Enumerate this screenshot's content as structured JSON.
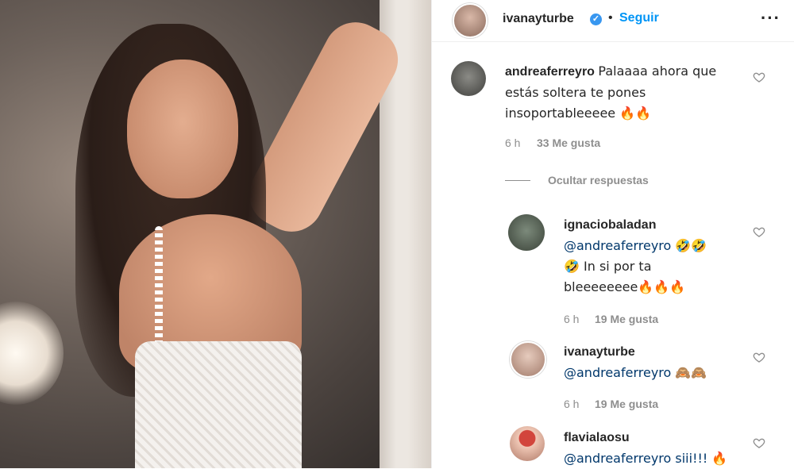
{
  "header": {
    "username": "ivanayturbe",
    "verified_mark": "✓",
    "separator": "•",
    "follow_label": "Seguir",
    "more_label": "···"
  },
  "comment": {
    "username": "andreaferreyro",
    "lines": [
      "Palaaaa ahora que",
      "estás soltera te pones",
      "insoportableeeee 🔥🔥"
    ],
    "time": "6 h",
    "likes": "33 Me gusta"
  },
  "hide_replies_label": "Ocultar respuestas",
  "replies": [
    {
      "username": "ignaciobaladan",
      "lines": [
        "@andreaferreyro 🤣🤣",
        "🤣 In si por ta",
        "bleeeeeeee🔥🔥🔥"
      ],
      "time": "6 h",
      "likes": "19 Me gusta"
    },
    {
      "username": "ivanayturbe",
      "lines": [
        "@andreaferreyro 🙈🙈"
      ],
      "time": "6 h",
      "likes": "19 Me gusta"
    },
    {
      "username": "flavialaosu",
      "lines": [
        "@andreaferreyro siii!!! 🔥"
      ]
    }
  ],
  "colors": {
    "follow": "#0095f6",
    "mention": "#00376b",
    "meta": "#8e8e8e",
    "verified": "#3897f0"
  },
  "icons": [
    "verified-badge-icon",
    "more-options-icon",
    "heart-icon"
  ]
}
